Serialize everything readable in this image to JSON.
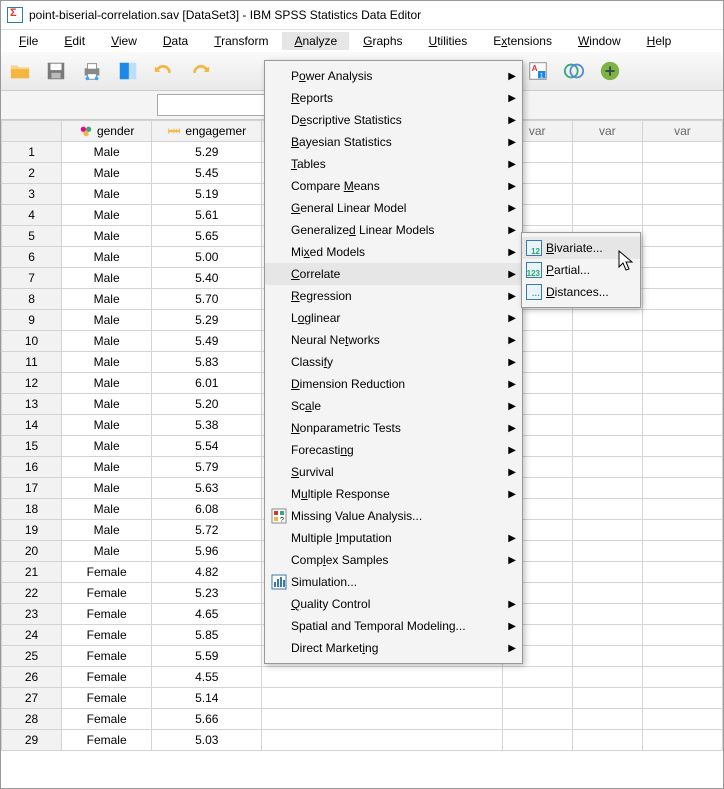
{
  "title": "point-biserial-correlation.sav [DataSet3] - IBM SPSS Statistics Data Editor",
  "menus": {
    "file": "File",
    "edit": "Edit",
    "view": "View",
    "data": "Data",
    "transform": "Transform",
    "analyze": "Analyze",
    "graphs": "Graphs",
    "utilities": "Utilities",
    "extensions": "Extensions",
    "window": "Window",
    "help": "Help"
  },
  "search": {
    "placeholder": ""
  },
  "columns": {
    "gender": "gender",
    "engagement": "engagemer",
    "var": "var"
  },
  "rows": [
    {
      "n": "1",
      "g": "Male",
      "e": "5.29"
    },
    {
      "n": "2",
      "g": "Male",
      "e": "5.45"
    },
    {
      "n": "3",
      "g": "Male",
      "e": "5.19"
    },
    {
      "n": "4",
      "g": "Male",
      "e": "5.61"
    },
    {
      "n": "5",
      "g": "Male",
      "e": "5.65"
    },
    {
      "n": "6",
      "g": "Male",
      "e": "5.00"
    },
    {
      "n": "7",
      "g": "Male",
      "e": "5.40"
    },
    {
      "n": "8",
      "g": "Male",
      "e": "5.70"
    },
    {
      "n": "9",
      "g": "Male",
      "e": "5.29"
    },
    {
      "n": "10",
      "g": "Male",
      "e": "5.49"
    },
    {
      "n": "11",
      "g": "Male",
      "e": "5.83"
    },
    {
      "n": "12",
      "g": "Male",
      "e": "6.01"
    },
    {
      "n": "13",
      "g": "Male",
      "e": "5.20"
    },
    {
      "n": "14",
      "g": "Male",
      "e": "5.38"
    },
    {
      "n": "15",
      "g": "Male",
      "e": "5.54"
    },
    {
      "n": "16",
      "g": "Male",
      "e": "5.79"
    },
    {
      "n": "17",
      "g": "Male",
      "e": "5.63"
    },
    {
      "n": "18",
      "g": "Male",
      "e": "6.08"
    },
    {
      "n": "19",
      "g": "Male",
      "e": "5.72"
    },
    {
      "n": "20",
      "g": "Male",
      "e": "5.96"
    },
    {
      "n": "21",
      "g": "Female",
      "e": "4.82"
    },
    {
      "n": "22",
      "g": "Female",
      "e": "5.23"
    },
    {
      "n": "23",
      "g": "Female",
      "e": "4.65"
    },
    {
      "n": "24",
      "g": "Female",
      "e": "5.85"
    },
    {
      "n": "25",
      "g": "Female",
      "e": "5.59"
    },
    {
      "n": "26",
      "g": "Female",
      "e": "4.55"
    },
    {
      "n": "27",
      "g": "Female",
      "e": "5.14"
    },
    {
      "n": "28",
      "g": "Female",
      "e": "5.66"
    },
    {
      "n": "29",
      "g": "Female",
      "e": "5.03"
    }
  ],
  "analyze_menu": [
    {
      "label": "Power Analysis",
      "sub": true,
      "u": 1
    },
    {
      "label": "Reports",
      "sub": true,
      "u": 0
    },
    {
      "label": "Descriptive Statistics",
      "sub": true,
      "u": 1
    },
    {
      "label": "Bayesian Statistics",
      "sub": true,
      "u": 0
    },
    {
      "label": "Tables",
      "sub": true,
      "u": 0
    },
    {
      "label": "Compare Means",
      "sub": true,
      "u": 8
    },
    {
      "label": "General Linear Model",
      "sub": true,
      "u": 0
    },
    {
      "label": "Generalized Linear Models",
      "sub": true,
      "u": 10
    },
    {
      "label": "Mixed Models",
      "sub": true,
      "u": 2
    },
    {
      "label": "Correlate",
      "sub": true,
      "u": 0,
      "hover": true
    },
    {
      "label": "Regression",
      "sub": true,
      "u": 0
    },
    {
      "label": "Loglinear",
      "sub": true,
      "u": 1
    },
    {
      "label": "Neural Networks",
      "sub": true,
      "u": 9
    },
    {
      "label": "Classify",
      "sub": true,
      "u": 6
    },
    {
      "label": "Dimension Reduction",
      "sub": true,
      "u": 0
    },
    {
      "label": "Scale",
      "sub": true,
      "u": 2
    },
    {
      "label": "Nonparametric Tests",
      "sub": true,
      "u": 0
    },
    {
      "label": "Forecasting",
      "sub": true,
      "u": 9
    },
    {
      "label": "Survival",
      "sub": true,
      "u": 0
    },
    {
      "label": "Multiple Response",
      "sub": true,
      "u": 1
    },
    {
      "label": "Missing Value Analysis...",
      "sub": false,
      "icon": "mva"
    },
    {
      "label": "Multiple Imputation",
      "sub": true,
      "u": 9
    },
    {
      "label": "Complex Samples",
      "sub": true,
      "u": 4
    },
    {
      "label": "Simulation...",
      "sub": false,
      "icon": "sim"
    },
    {
      "label": "Quality Control",
      "sub": true,
      "u": 0
    },
    {
      "label": "Spatial and Temporal Modeling...",
      "sub": true
    },
    {
      "label": "Direct Marketing",
      "sub": true,
      "u": 13
    }
  ],
  "correlate_submenu": [
    {
      "label": "Bivariate...",
      "u": 0,
      "hover": true,
      "t": "12"
    },
    {
      "label": "Partial...",
      "u": 0,
      "t": "123"
    },
    {
      "label": "Distances...",
      "u": 0,
      "t": "···"
    }
  ]
}
